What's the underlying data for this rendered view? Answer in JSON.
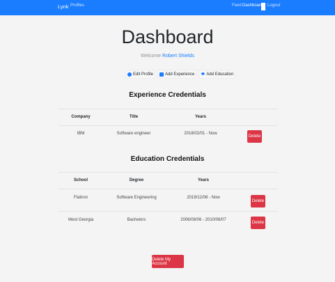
{
  "navbar": {
    "brand": "Lynk",
    "profiles": "Profiles",
    "feed": "Feed",
    "dashboard": "Dashboard",
    "logout": "Logout"
  },
  "page": {
    "title": "Dashboard",
    "welcome_prefix": "Welcome",
    "user_name": "Robert Shields"
  },
  "actions": {
    "edit_profile": "Edit Profile",
    "add_experience": "Add Experience",
    "add_education": "Add Education"
  },
  "experience": {
    "title": "Experience Credentials",
    "headers": [
      "Company",
      "Title",
      "Years"
    ],
    "rows": [
      {
        "company": "IBM",
        "title": "Software engineer",
        "years": "2018/02/01 - Now",
        "action": "Delete"
      }
    ]
  },
  "education": {
    "title": "Education Credentials",
    "headers": [
      "School",
      "Degree",
      "Years"
    ],
    "rows": [
      {
        "school": "Flatiron",
        "degree": "Software Engineering",
        "years": "2019/12/08 - Now",
        "action": "Delete"
      },
      {
        "school": "West Georgia",
        "degree": "Bachelors",
        "years": "2006/08/06 - 2010/06/07",
        "action": "Delete"
      }
    ]
  },
  "footer": {
    "delete_account": "Delete My Account"
  },
  "colors": {
    "navbar": "#1a7cff",
    "danger": "#dc3545",
    "link": "#1a7cff"
  }
}
